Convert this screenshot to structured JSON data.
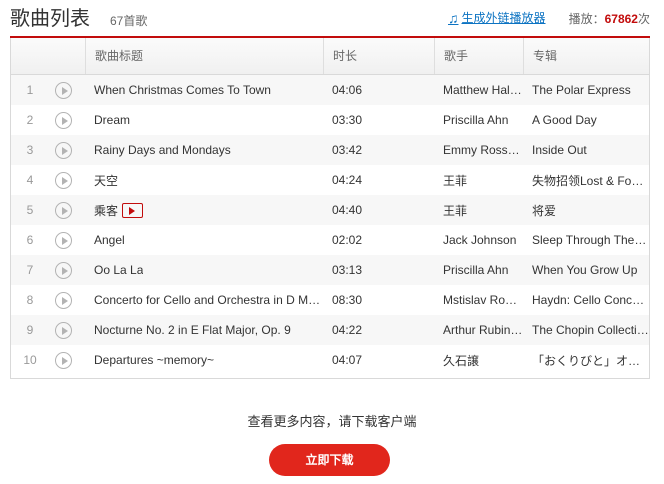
{
  "header": {
    "title": "歌曲列表",
    "count": "67首歌",
    "generate_link": "生成外链播放器",
    "play_label": "播放：",
    "play_count": "67862",
    "play_suffix": "次"
  },
  "table": {
    "headers": [
      "",
      "歌曲标题",
      "时长",
      "歌手",
      "专辑"
    ],
    "rows": [
      {
        "idx": "1",
        "title": "When Christmas Comes To Town",
        "time": "04:06",
        "singer": "Matthew Hall / Meagan Moore",
        "album": "The Polar Express",
        "mv": false
      },
      {
        "idx": "2",
        "title": "Dream",
        "time": "03:30",
        "singer": "Priscilla Ahn",
        "album": "A Good Day",
        "mv": false
      },
      {
        "idx": "3",
        "title": "Rainy Days and Mondays",
        "time": "03:42",
        "singer": "Emmy Rossum",
        "album": "Inside Out",
        "mv": false
      },
      {
        "idx": "4",
        "title": "天空",
        "time": "04:24",
        "singer": "王菲",
        "album": "失物招领Lost & Found",
        "mv": false
      },
      {
        "idx": "5",
        "title": "乘客",
        "time": "04:40",
        "singer": "王菲",
        "album": "将爱",
        "mv": true
      },
      {
        "idx": "6",
        "title": "Angel",
        "time": "02:02",
        "singer": "Jack Johnson",
        "album": "Sleep Through The Static",
        "mv": false
      },
      {
        "idx": "7",
        "title": "Oo La La",
        "time": "03:13",
        "singer": "Priscilla Ahn",
        "album": "When You Grow Up",
        "mv": false
      },
      {
        "idx": "8",
        "title": "Concerto for Cello and Orchestra in D Major",
        "time": "08:30",
        "singer": "Mstislav Rostropovich",
        "album": "Haydn: Cello Concertos",
        "mv": false
      },
      {
        "idx": "9",
        "title": "Nocturne No. 2 in E Flat Major, Op. 9",
        "time": "04:22",
        "singer": "Arthur Rubinstein",
        "album": "The Chopin Collection",
        "mv": false
      },
      {
        "idx": "10",
        "title": "Departures ~memory~",
        "time": "04:07",
        "singer": "久石譲",
        "album": "「おくりびと」オリジナルサウンドトラック",
        "mv": false
      }
    ]
  },
  "footer": {
    "more_text": "查看更多内容，请下载客户端",
    "download_button": "立即下载"
  },
  "colors": {
    "accent": "#c20c0c",
    "link": "#0c73c2",
    "button": "#e1261c"
  }
}
